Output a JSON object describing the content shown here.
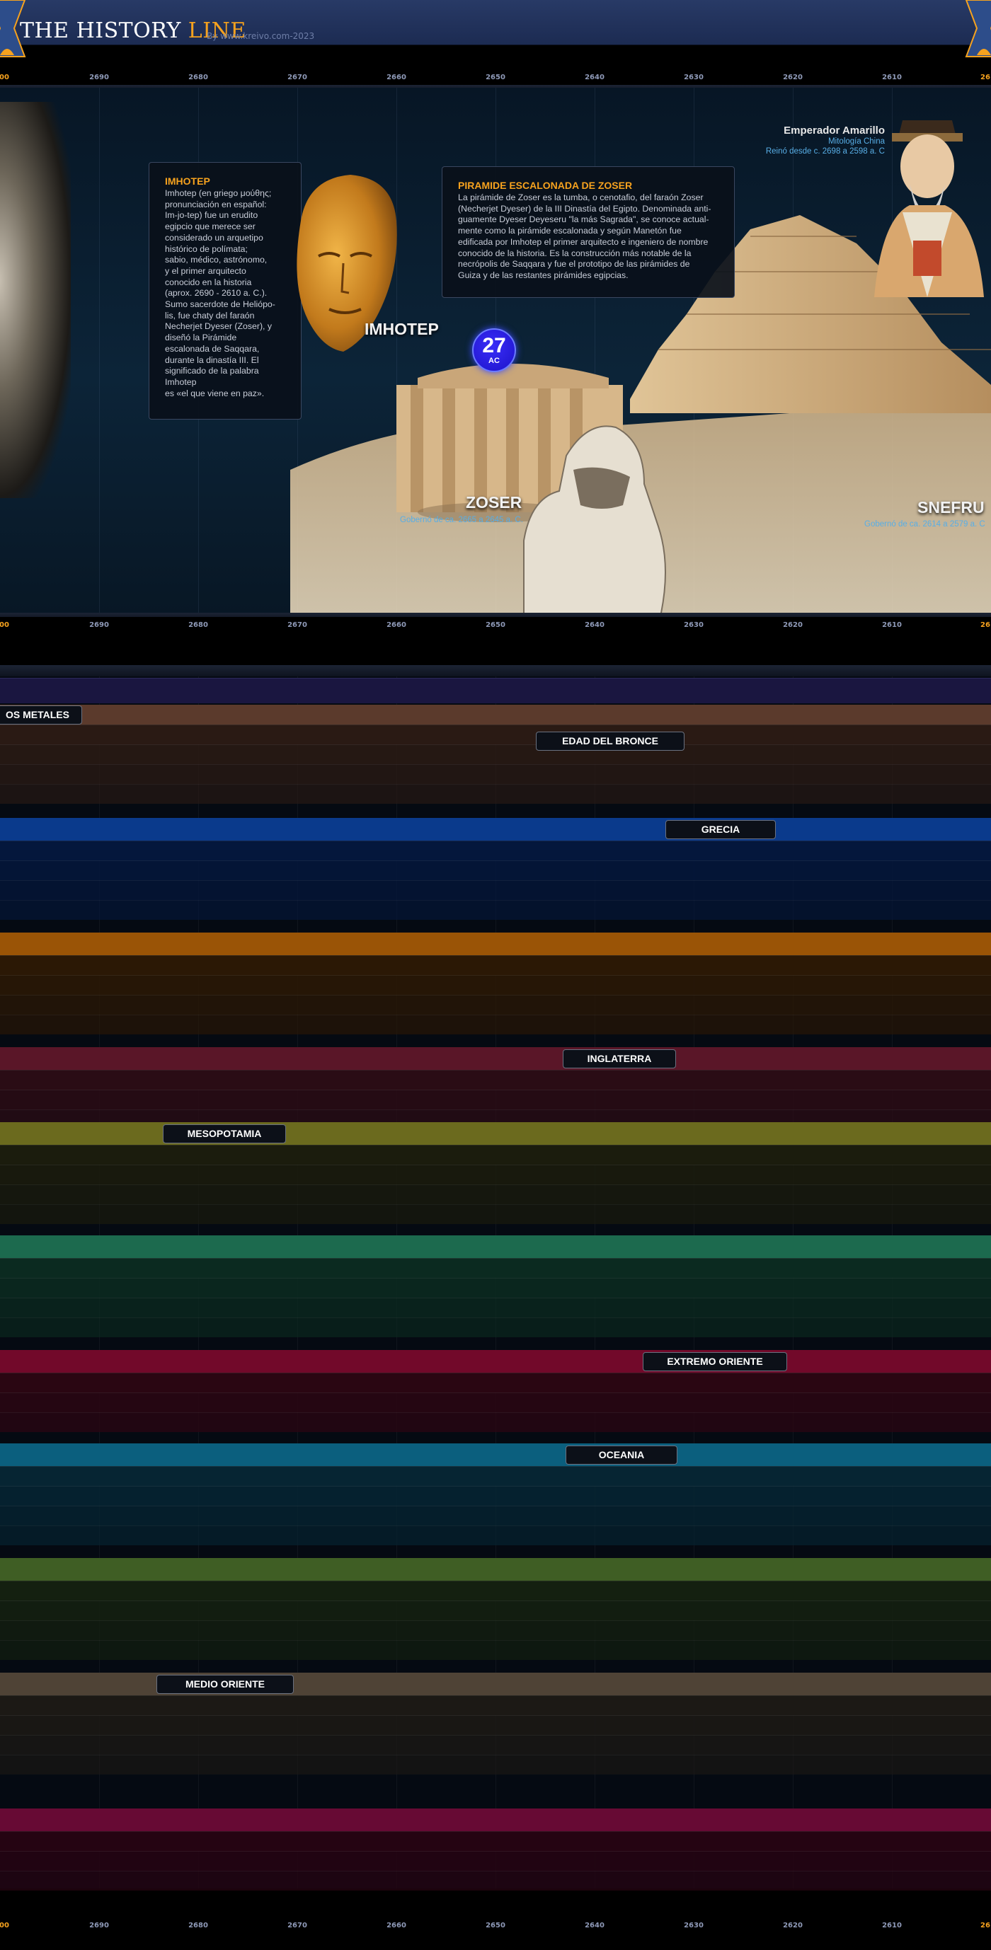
{
  "header": {
    "logo_white": "THE HISTORY ",
    "logo_orange": "LINE",
    "byline": "By www.kreivo.com-2023"
  },
  "ruler": {
    "ticks": [
      "00",
      "2690",
      "2680",
      "2670",
      "2660",
      "2650",
      "2640",
      "2630",
      "2620",
      "2610",
      "26"
    ]
  },
  "hero": {
    "imhotep_box": {
      "title": "IMHOTEP",
      "text": "Imhotep (en griego μούθης;\npronunciación en español:\nIm-jo-tep) fue un erudito\negipcio que merece ser\nconsiderado un arquetipo\nhistórico de polímata;\nsabio, médico, astrónomo,\ny el primer arquitecto\nconocido en la historia\n(aprox. 2690 - 2610 a. C.).\nSumo sacerdote de Heliópo-\nlis, fue chaty del faraón\nNecherjet Dyeser (Zoser), y\ndiseñó la Pirámide\nescalonada de Saqqara,\ndurante la dinastía III. El\nsignificado de la palabra\nImhotep\nes «el que viene en paz»."
    },
    "pyramid_box": {
      "title": "PIRAMIDE ESCALONADA DE ZOSER",
      "text": "La pirámide de Zoser es la tumba, o cenotafio, del faraón Zoser\n(Necherjet Dyeser) de la III Dinastía del Egipto. Denominada anti-\nguamente Dyeser Deyeseru \"la más Sagrada\", se conoce actual-\nmente como la pirámide escalonada y según Manetón fue\nedificada por Imhotep el primer arquitecto e ingeniero de nombre\nconocido de la historia. Es la construcción más notable de la\nnecrópolis de Saqqara  y fue el prototipo de las pirámides de\nGuiza y de las restantes pirámides egipcias."
    },
    "imhotep_name": "IMHOTEP",
    "zoser_name": "ZOSER",
    "zoser_reign": "Gobernó de ca. 2665 a 2645 a. C.",
    "snefru_name": "SNEFRU",
    "snefru_reign": "Gobernó de ca. 2614 a 2579 a. C",
    "emperor": {
      "name": "Emperador Amarillo",
      "sub": "Mitología China",
      "reign": "Reinó desde c. 2698 a 2598 a. C"
    },
    "century": {
      "num": "27",
      "era": "AC"
    }
  },
  "bands": [
    {
      "id": "metales",
      "label": "OS METALES",
      "color": "#5b3a2c",
      "dark": "#2a1a14"
    },
    {
      "id": "bronce",
      "label": "EDAD DEL BRONCE"
    },
    {
      "id": "grecia",
      "label": "GRECIA",
      "color": "#0a3a8c",
      "dark": "#04173c"
    },
    {
      "id": "egipto",
      "label": "",
      "color": "#9a5406",
      "dark": "#2b1805"
    },
    {
      "id": "inglaterra",
      "label": "INGLATERRA",
      "color": "#5a1628",
      "dark": "#2a0c15"
    },
    {
      "id": "mesopotamia",
      "label": "MESOPOTAMIA",
      "color": "#6b6a1e",
      "dark": "#1b1c0d"
    },
    {
      "id": "roma",
      "label": "",
      "color": "#1c6a4e",
      "dark": "#0b2a20"
    },
    {
      "id": "oriente",
      "label": "EXTREMO ORIENTE",
      "color": "#72092a",
      "dark": "#2a0612"
    },
    {
      "id": "oceania",
      "label": "OCEANIA",
      "color": "#0b5f7e",
      "dark": "#062533"
    },
    {
      "id": "america",
      "label": "",
      "color": "#3f5e24",
      "dark": "#142010"
    },
    {
      "id": "medio",
      "label": "MEDIO ORIENTE",
      "color": "#4f4336",
      "dark": "#1c1915"
    },
    {
      "id": "africa",
      "label": "",
      "color": "#670a34",
      "dark": "#250412"
    }
  ]
}
